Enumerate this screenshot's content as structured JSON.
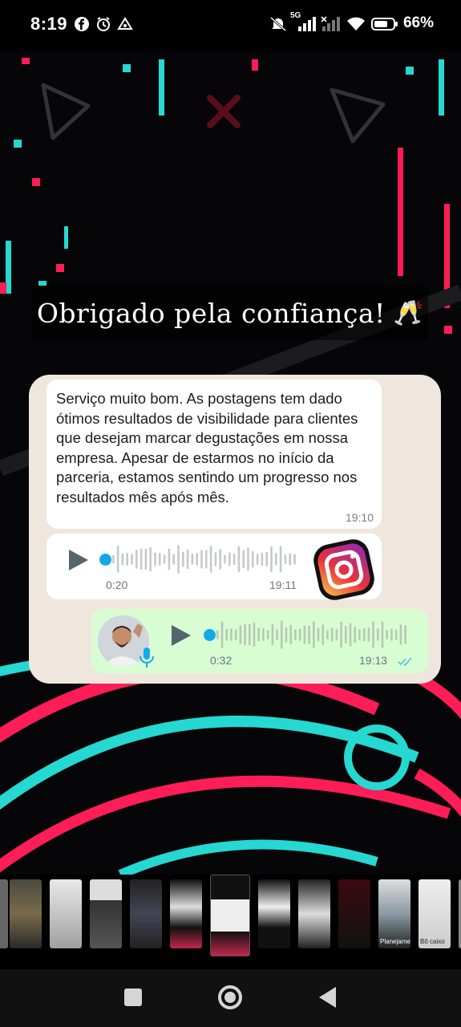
{
  "status_bar": {
    "time": "8:19",
    "network": "5G",
    "battery": "66%",
    "icons": [
      "facebook-icon",
      "alarm-icon",
      "cloud-icon",
      "mute-icon",
      "signal-icon",
      "wifi-icon",
      "battery-icon"
    ]
  },
  "story": {
    "title": "Obrigado pela confiança!",
    "title_emoji": "🥂",
    "chat": {
      "message": "Serviço muito bom. As postagens tem dado ótimos resultados de visibilidade para clientes que desejam marcar degustações em nossa empresa. Apesar de estarmos no início da parceria, estamos sentindo um progresso nos resultados mês após mês.",
      "message_time": "19:10",
      "audio_in": {
        "duration": "0:20",
        "time": "19:11"
      },
      "audio_out": {
        "duration": "0:32",
        "time": "19:13"
      }
    },
    "colors": {
      "neon_pink": "#ff1d58",
      "neon_cyan": "#25d8d2",
      "chat_bg": "#efe7dd",
      "outgoing": "#d9fdd3",
      "accent_blue": "#13a9e8"
    }
  },
  "thumbnails": {
    "labels": [
      "Planejamentos",
      "Bô caixo"
    ],
    "count": 12,
    "active_index": 5
  },
  "nav": {
    "icons": [
      "recents-icon",
      "home-icon",
      "back-icon"
    ]
  }
}
